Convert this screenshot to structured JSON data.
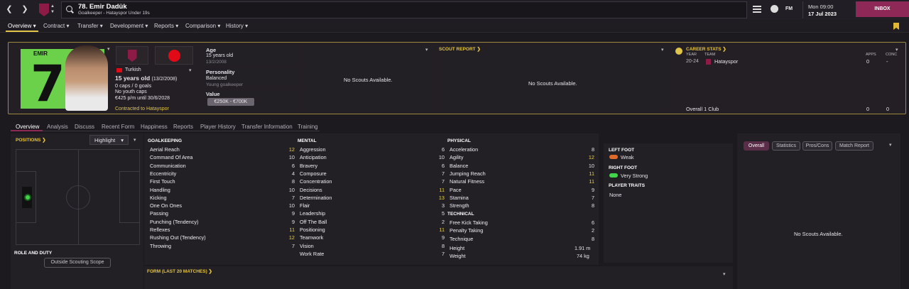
{
  "header": {
    "player_title": "78. Emir Dadük",
    "player_sub": "Goalkeeper - Hatayspor Under 19s",
    "date": "Mon 09:00",
    "date2": "17 Jul 2023",
    "inbox": "INBOX",
    "fm": "FM"
  },
  "menu": [
    "Overview",
    "Contract",
    "Transfer",
    "Development",
    "Reports",
    "Comparison",
    "History"
  ],
  "card": {
    "nationality": "Turkish",
    "age_line": "15 years old",
    "dob_short": "(13/2/2008)",
    "caps": "0 caps / 0 goals",
    "youth_caps": "No youth caps",
    "contract_line": "€425 p/m until 30/6/2028",
    "contracted": "Contracted to Hatayspor",
    "age_label": "Age",
    "age_val": "15 years old",
    "age_dob": "13/2/2008",
    "personality_label": "Personality",
    "personality_val": "Balanced",
    "personality_sub": "Young goalkeeper",
    "value_label": "Value",
    "value_val": "€250K - €700K",
    "no_scouts": "No Scouts Available.",
    "scout_report": "SCOUT REPORT",
    "no_scouts2": "No Scouts Available.",
    "career_stats": "CAREER STATS",
    "col_year": "YEAR",
    "col_team": "TEAM",
    "col_apps": "APPS",
    "col_conc": "CONC",
    "row_year": "20-24",
    "row_team": "Hatayspor",
    "row_apps": "0",
    "row_conc": "-",
    "overall": "Overall 1 Club",
    "overall_apps": "0",
    "overall_conc": "0",
    "shirt_num": "7",
    "shirt_name": "EMIR"
  },
  "subtabs": [
    "Overview",
    "Analysis",
    "Discuss",
    "Recent Form",
    "Happiness",
    "Reports",
    "Player History",
    "Transfer Information",
    "Training"
  ],
  "positions": {
    "title": "POSITIONS",
    "dropdown": "Highlight",
    "role_duty": "ROLE AND DUTY",
    "outside": "Outside Scouting Scope"
  },
  "goalkeeping": {
    "title": "GOALKEEPING",
    "attrs": [
      [
        "Aerial Reach",
        "12"
      ],
      [
        "Command Of Area",
        "10"
      ],
      [
        "Communication",
        "6"
      ],
      [
        "Eccentricity",
        "4"
      ],
      [
        "First Touch",
        "8"
      ],
      [
        "Handling",
        "10"
      ],
      [
        "Kicking",
        "7"
      ],
      [
        "One On Ones",
        "10"
      ],
      [
        "Passing",
        "9"
      ],
      [
        "Punching (Tendency)",
        "9"
      ],
      [
        "Reflexes",
        "11"
      ],
      [
        "Rushing Out (Tendency)",
        "12"
      ],
      [
        "Throwing",
        "7"
      ]
    ]
  },
  "mental": {
    "title": "MENTAL",
    "attrs": [
      [
        "Aggression",
        "6"
      ],
      [
        "Anticipation",
        "10"
      ],
      [
        "Bravery",
        "6"
      ],
      [
        "Composure",
        "7"
      ],
      [
        "Concentration",
        "7"
      ],
      [
        "Decisions",
        "11"
      ],
      [
        "Determination",
        "13"
      ],
      [
        "Flair",
        "3"
      ],
      [
        "Leadership",
        "5"
      ],
      [
        "Off The Ball",
        "2"
      ],
      [
        "Positioning",
        "11"
      ],
      [
        "Teamwork",
        "9"
      ],
      [
        "Vision",
        "8"
      ],
      [
        "Work Rate",
        "7"
      ]
    ]
  },
  "physical": {
    "title": "PHYSICAL",
    "attrs": [
      [
        "Acceleration",
        "8"
      ],
      [
        "Agility",
        "12"
      ],
      [
        "Balance",
        "10"
      ],
      [
        "Jumping Reach",
        "11"
      ],
      [
        "Natural Fitness",
        "11"
      ],
      [
        "Pace",
        "9"
      ],
      [
        "Stamina",
        "7"
      ],
      [
        "Strength",
        "8"
      ]
    ]
  },
  "technical": {
    "title": "TECHNICAL",
    "attrs": [
      [
        "Free Kick Taking",
        "6"
      ],
      [
        "Penalty Taking",
        "2"
      ],
      [
        "Technique",
        "8"
      ]
    ]
  },
  "body": {
    "height_label": "Height",
    "height_val": "1.91 m",
    "weight_label": "Weight",
    "weight_val": "74 kg"
  },
  "feet": {
    "left_label": "LEFT FOOT",
    "left_val": "Weak",
    "right_label": "RIGHT FOOT",
    "right_val": "Very Strong",
    "traits_label": "PLAYER TRAITS",
    "traits_val": "None"
  },
  "form": {
    "title": "FORM (LAST 20 MATCHES)"
  },
  "rightpanel": {
    "tabs": [
      "Overall",
      "Statistics",
      "Pros/Cons",
      "Match Report"
    ],
    "no_scouts": "No Scouts Available."
  }
}
